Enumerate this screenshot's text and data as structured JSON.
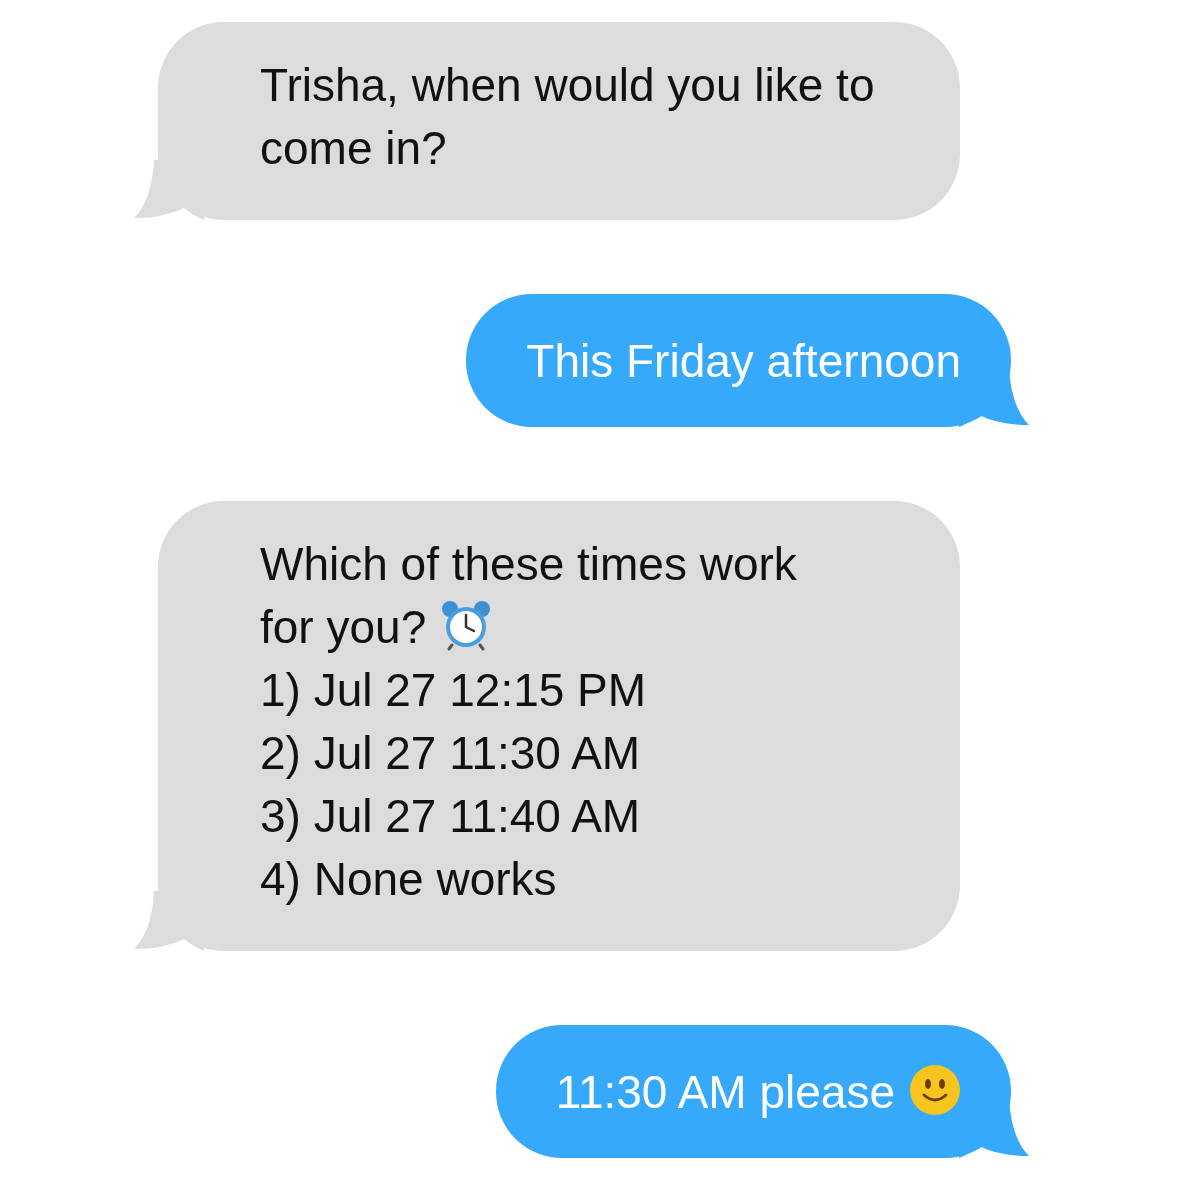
{
  "messages": [
    {
      "kind": "received",
      "lines": [
        {
          "kind": "plain",
          "text": "Trisha, when would you like to come in?"
        }
      ]
    },
    {
      "kind": "sent",
      "lines": [
        {
          "kind": "plain",
          "text": "This Friday afternoon"
        }
      ]
    },
    {
      "kind": "received",
      "lines": [
        {
          "kind": "plain",
          "text": "Which of these times work"
        },
        {
          "kind": "alarm",
          "text": "for you?"
        },
        {
          "kind": "plain",
          "text": "1) Jul 27 12:15 PM"
        },
        {
          "kind": "plain",
          "text": "2) Jul 27 11:30 AM"
        },
        {
          "kind": "plain",
          "text": "3) Jul 27 11:40 AM"
        },
        {
          "kind": "plain",
          "text": "4) None works"
        }
      ]
    },
    {
      "kind": "sent",
      "lines": [
        {
          "kind": "smile",
          "text": "11:30 AM please"
        }
      ]
    }
  ]
}
